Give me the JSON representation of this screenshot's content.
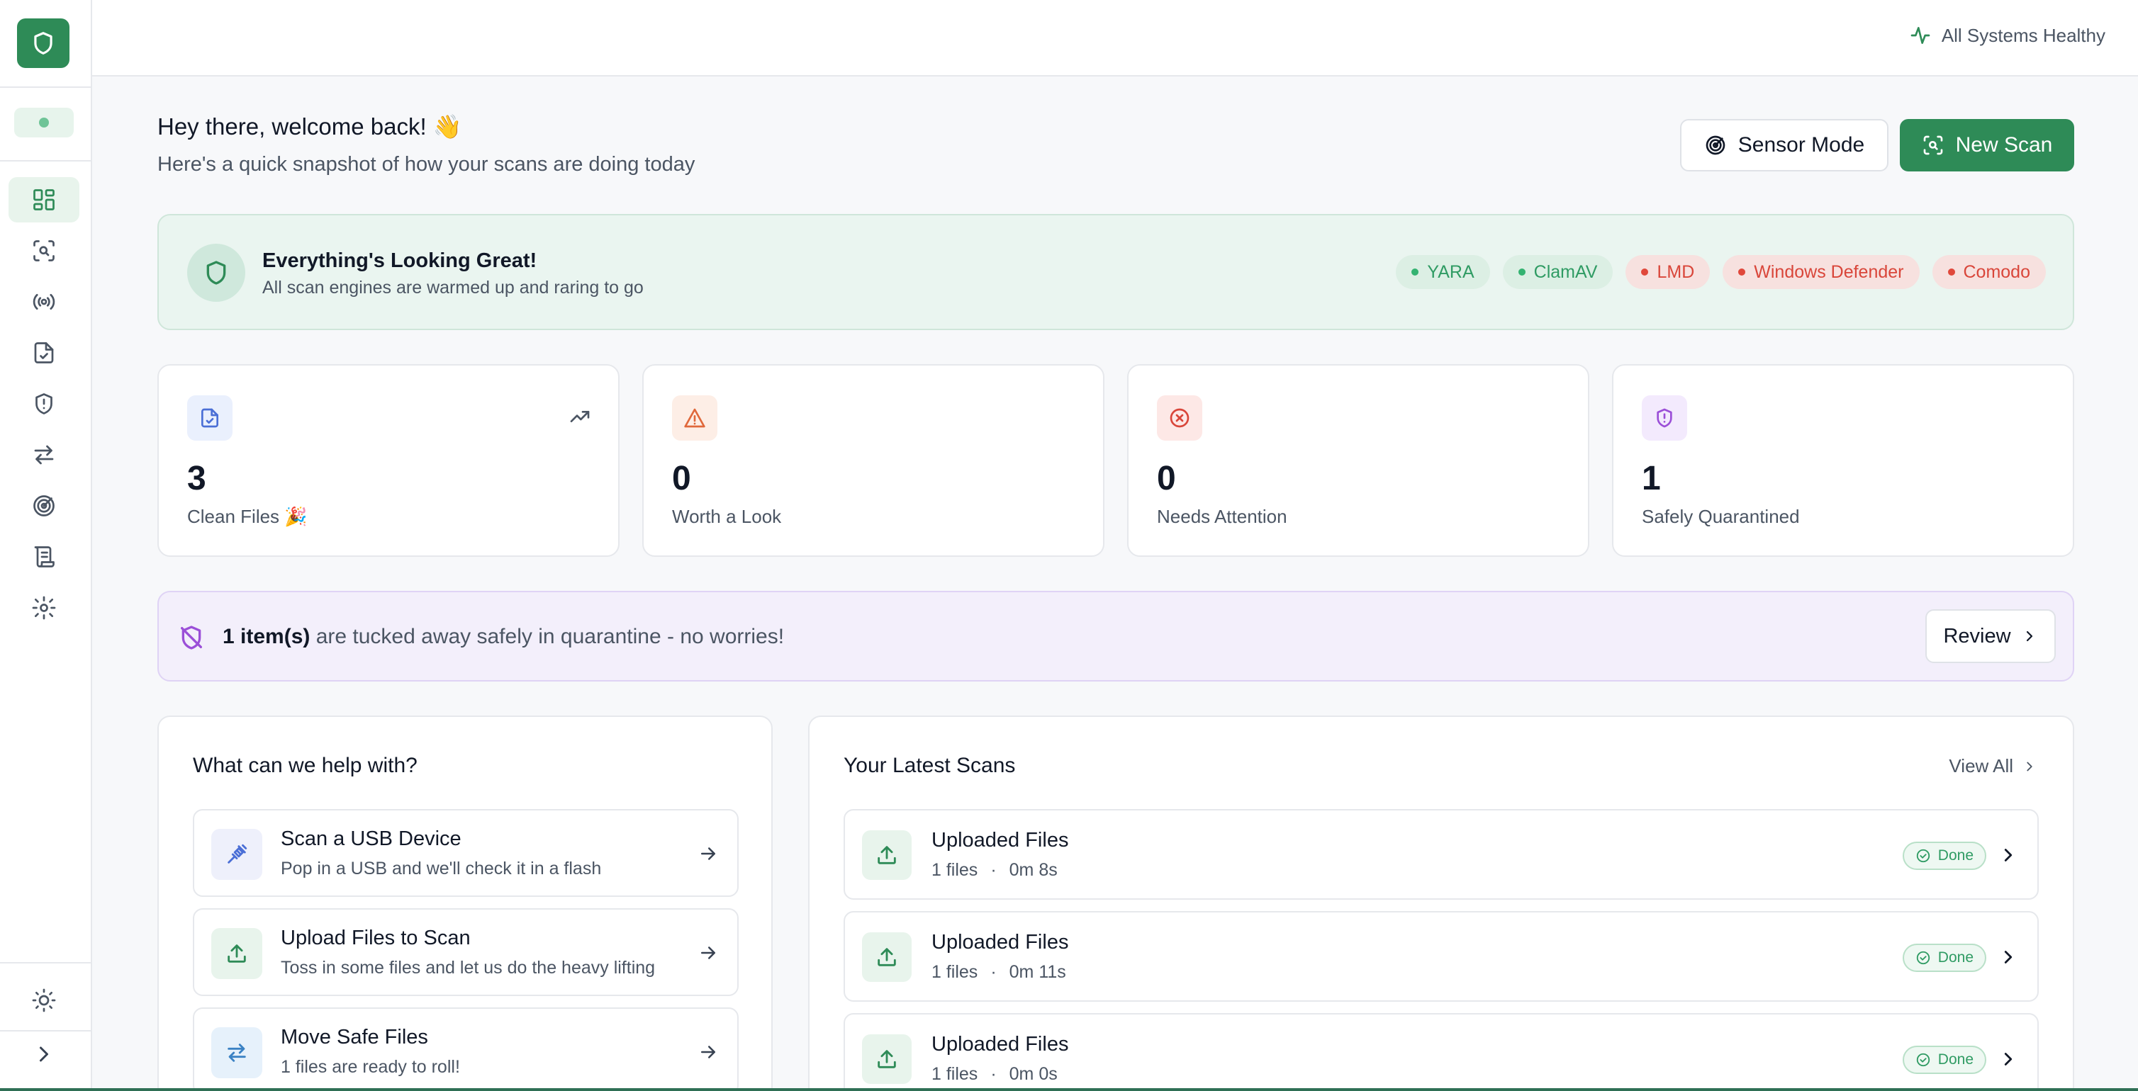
{
  "sidebar": {
    "nav_items": [
      "dashboard",
      "scan",
      "sensor",
      "reports",
      "quarantine",
      "transfer",
      "radar",
      "logs",
      "settings"
    ],
    "active": "dashboard"
  },
  "topbar": {
    "health_text": "All Systems Healthy"
  },
  "welcome": {
    "title": "Hey there, welcome back! 👋",
    "subtitle": "Here's a quick snapshot of how your scans are doing today"
  },
  "actions": {
    "sensor_mode": "Sensor Mode",
    "new_scan": "New Scan"
  },
  "banner": {
    "title": "Everything's Looking Great!",
    "subtitle": "All scan engines are warmed up and raring to go",
    "engines": [
      {
        "name": "YARA",
        "status": "ok"
      },
      {
        "name": "ClamAV",
        "status": "ok"
      },
      {
        "name": "LMD",
        "status": "error"
      },
      {
        "name": "Windows Defender",
        "status": "error"
      },
      {
        "name": "Comodo",
        "status": "error"
      }
    ]
  },
  "stats": [
    {
      "value": "3",
      "label": "Clean Files 🎉",
      "color": "#4b6fd6"
    },
    {
      "value": "0",
      "label": "Worth a Look",
      "color": "#e0683b"
    },
    {
      "value": "0",
      "label": "Needs Attention",
      "color": "#d9463a"
    },
    {
      "value": "1",
      "label": "Safely Quarantined",
      "color": "#9b4fd8"
    }
  ],
  "quarantine": {
    "count_text": "1 item(s)",
    "message": " are tucked away safely in quarantine - no worries!",
    "review": "Review"
  },
  "help": {
    "title": "What can we help with?",
    "items": [
      {
        "title": "Scan a USB Device",
        "subtitle": "Pop in a USB and we'll check it in a flash"
      },
      {
        "title": "Upload Files to Scan",
        "subtitle": "Toss in some files and let us do the heavy lifting"
      },
      {
        "title": "Move Safe Files",
        "subtitle": "1 files are ready to roll!"
      }
    ]
  },
  "scans": {
    "title": "Your Latest Scans",
    "view_all": "View All",
    "items": [
      {
        "title": "Uploaded Files",
        "files": "1 files",
        "sep": "·",
        "duration": "0m 8s",
        "status": "Done"
      },
      {
        "title": "Uploaded Files",
        "files": "1 files",
        "sep": "·",
        "duration": "0m 11s",
        "status": "Done"
      },
      {
        "title": "Uploaded Files",
        "files": "1 files",
        "sep": "·",
        "duration": "0m 0s",
        "status": "Done"
      }
    ]
  }
}
